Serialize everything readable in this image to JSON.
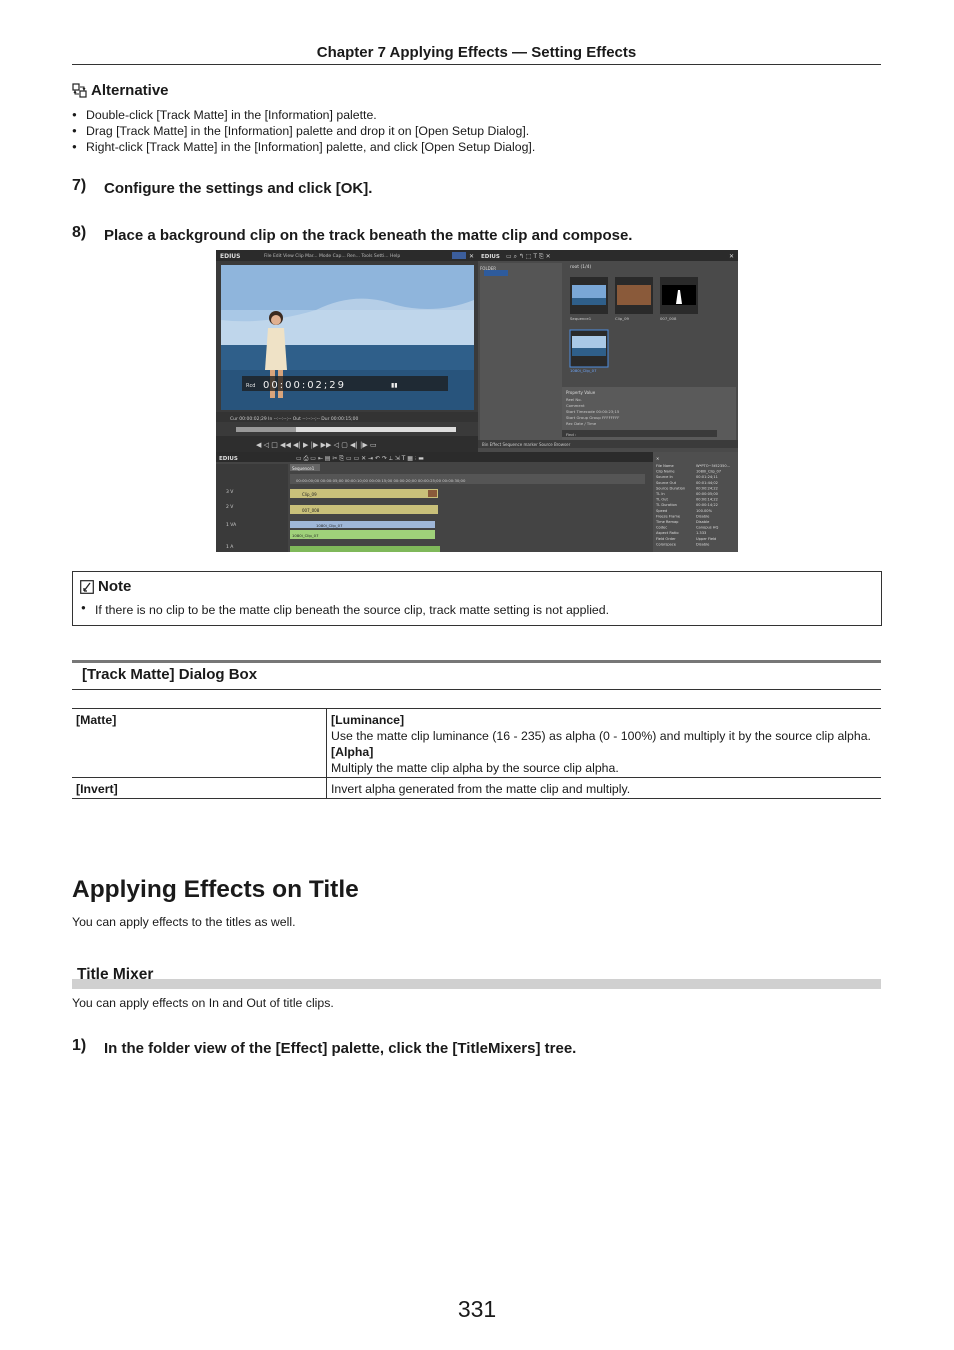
{
  "header": {
    "chapter": "Chapter 7   Applying Effects — Setting Effects"
  },
  "alternative": {
    "title": "Alternative",
    "items": [
      "Double-click [Track Matte] in the [Information] palette.",
      "Drag [Track Matte] in the [Information] palette and drop it on [Open Setup Dialog].",
      "Right-click [Track Matte] in the [Information] palette, and click [Open Setup Dialog]."
    ]
  },
  "steps": [
    {
      "num": "7)",
      "text": "Configure the settings and click [OK]."
    },
    {
      "num": "8)",
      "text": "Place a background clip on the track beneath the matte clip and compose."
    }
  ],
  "screenshot": {
    "app_name": "EDIUS",
    "menu": [
      "File",
      "Edit",
      "View",
      "Clip",
      "Mar...",
      "Mode",
      "Cap...",
      "Ren...",
      "Tools",
      "Setti...",
      "Help"
    ],
    "timecode": "00:00:02;29",
    "rec_label": "Rcd",
    "sequence_tab": "Sequence1",
    "bin_title": "root (1/4)",
    "bin_clips": [
      "Sequence1",
      "Clip_09",
      "007_008",
      "1080i_Clip_07"
    ],
    "palette_tabs": [
      "Bin",
      "Effect",
      "Sequence marker",
      "Source Browser"
    ],
    "track_labels": [
      "V",
      "V",
      "VA",
      "A"
    ],
    "timeline_clips": [
      "Clip_09",
      "007_008",
      "1080i_Clip_07",
      "1080i_Clip_07"
    ],
    "info_props": [
      "File Name",
      "Clip Name",
      "Source In",
      "Source Out",
      "Source Duration",
      "TL In",
      "TL Out",
      "TL Duration",
      "Speed",
      "Freeze Frame",
      "Time Remap",
      "Codec",
      "Aspect Ratio",
      "Field Order",
      "Colorspace"
    ],
    "info_vals": [
      "W*PTO~5t52350...",
      "1080i_Clip_07",
      "00:01:24;11",
      "00:01:44;02",
      "00:00:24;22",
      "00:00:05;00",
      "00:00:14;22",
      "00:00:14;22",
      "100.00%",
      "Disable",
      "Disable",
      "Canopus HQ",
      "1.333",
      "Upper Field",
      "Disable"
    ],
    "colors": {
      "ui_dark": "#3c3c3c",
      "panel": "#4a4a4a",
      "clip_video": "#c9c07a",
      "clip_audio": "#9fd17a",
      "sky": "#a9c8e6",
      "sea": "#2f5f8a"
    }
  },
  "note": {
    "title": "Note",
    "text": "If there is no clip to be the matte clip beneath the source clip, track matte setting is not applied."
  },
  "track_matte_section": {
    "title": "[Track Matte] Dialog Box",
    "rows": [
      {
        "key": "[Matte]",
        "lines": [
          {
            "bold": true,
            "text": "[Luminance]"
          },
          {
            "bold": false,
            "text": "Use the matte clip luminance (16 - 235) as alpha (0 - 100%) and multiply it by the source clip alpha."
          },
          {
            "bold": true,
            "text": "[Alpha]"
          },
          {
            "bold": false,
            "text": "Multiply the matte clip alpha by the source clip alpha."
          }
        ]
      },
      {
        "key": "[Invert]",
        "lines": [
          {
            "bold": false,
            "text": "Invert alpha generated from the matte clip and multiply."
          }
        ]
      }
    ]
  },
  "applying_title": {
    "heading": "Applying Effects on Title",
    "intro": "You can apply effects to the titles as well.",
    "subheading": "Title Mixer",
    "sub_intro": "You can apply effects on In and Out of title clips.",
    "step": {
      "num": "1)",
      "text": "In the folder view of the [Effect] palette, click the [TitleMixers] tree."
    }
  },
  "page_number": "331"
}
